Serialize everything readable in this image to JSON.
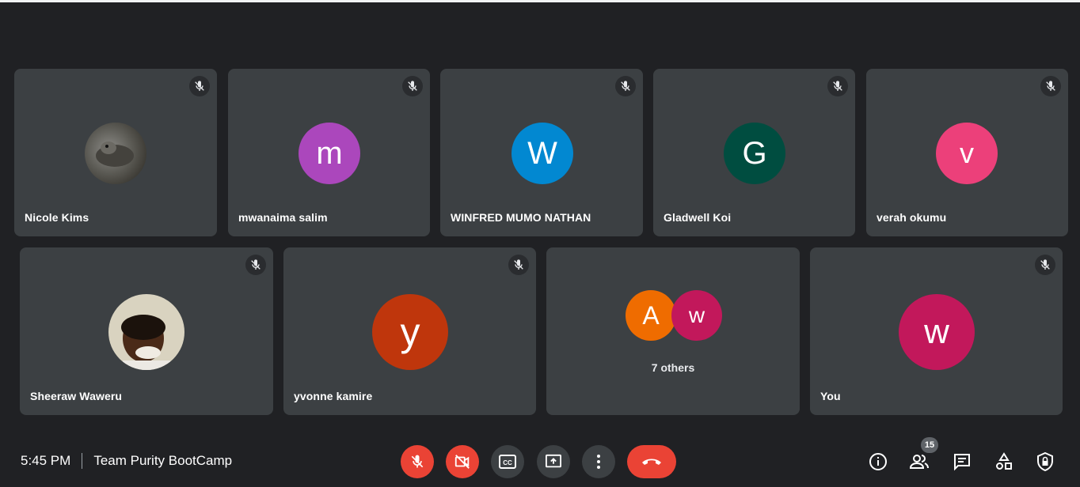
{
  "participants_row1": [
    {
      "name": "Nicole Kims",
      "avatar": "photo",
      "muted": true
    },
    {
      "name": "mwanaima salim",
      "initial": "m",
      "color": "#ab47bc",
      "muted": true
    },
    {
      "name": "WINFRED MUMO NATHAN",
      "initial": "W",
      "color": "#0288d1",
      "muted": true
    },
    {
      "name": "Gladwell Koi",
      "initial": "G",
      "color": "#004d40",
      "muted": true
    },
    {
      "name": "verah okumu",
      "initial": "v",
      "color": "#ec407a",
      "muted": true
    }
  ],
  "participants_row2": [
    {
      "name": "Sheeraw Waweru",
      "avatar": "photo",
      "muted": true
    },
    {
      "name": "yvonne kamire",
      "initial": "y",
      "color": "#bf360c",
      "muted": true
    },
    {
      "group": true,
      "label": "7 others",
      "initials": [
        "A",
        "w"
      ],
      "colors": [
        "#ef6c00",
        "#c2185b"
      ]
    },
    {
      "name": "You",
      "initial": "w",
      "color": "#c2185b",
      "muted": true
    }
  ],
  "meeting": {
    "time": "5:45 PM",
    "title": "Team Purity BootCamp"
  },
  "controls": {
    "mic": "mic-off-icon",
    "camera": "camera-off-icon",
    "captions": "CC",
    "present": "present-icon",
    "more": "more-icon",
    "hangup": "hangup-icon"
  },
  "right_controls": {
    "people_count": "15"
  }
}
